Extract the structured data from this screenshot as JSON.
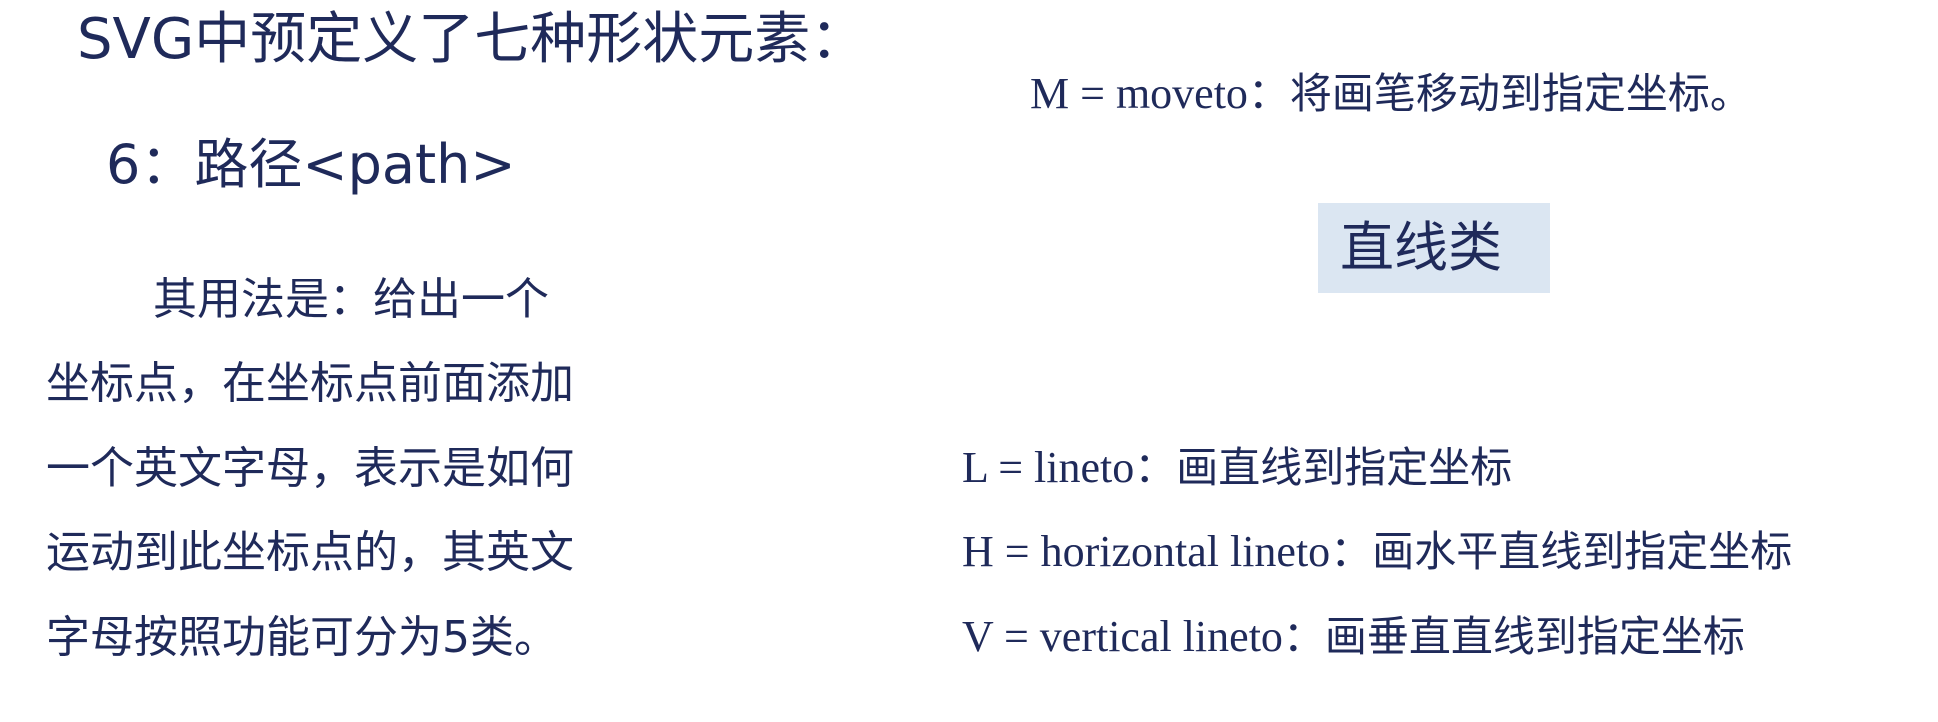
{
  "title": "SVG中预定义了七种形状元素：",
  "section": "6：路径<path>",
  "description": [
    "其用法是：给出一个",
    "坐标点，在坐标点前面添加",
    "一个英文字母，表示是如何",
    "运动到此坐标点的，其英文",
    "字母按照功能可分为5类。"
  ],
  "move_command": {
    "key": "M = moveto",
    "desc": "：将画笔移动到指定坐标。"
  },
  "category": {
    "label": "直线类"
  },
  "line_commands": [
    {
      "key": "L = lineto",
      "desc": "：画直线到指定坐标"
    },
    {
      "key": "H = horizontal lineto",
      "desc": "：画水平直线到指定坐标"
    },
    {
      "key": "V = vertical lineto",
      "desc": "：画垂直直线到指定坐标"
    }
  ]
}
